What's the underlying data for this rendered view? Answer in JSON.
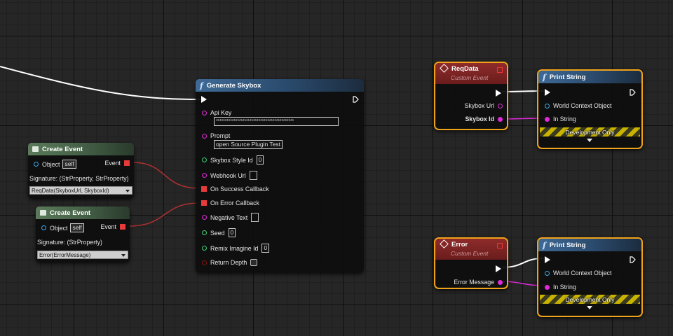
{
  "generate_skybox": {
    "title": "Generate Skybox",
    "api_key_label": "Api Key",
    "api_key_value": "********************************************",
    "prompt_label": "Prompt",
    "prompt_value": "open Source Plugin Test",
    "skybox_style_id_label": "Skybox Style Id",
    "skybox_style_id_value": "0",
    "webhook_url_label": "Webhook Url",
    "on_success_label": "On Success Callback",
    "on_error_label": "On Error Callback",
    "negative_text_label": "Negative Text",
    "seed_label": "Seed",
    "seed_value": "0",
    "remix_label": "Remix Imagine Id",
    "remix_value": "0",
    "return_depth_label": "Return Depth"
  },
  "create_event_1": {
    "title": "Create Event",
    "object_label": "Object",
    "object_value": "self",
    "event_label": "Event",
    "signature": "Signature: (StrProperty, StrProperty)",
    "function_value": "ReqData(SkyboxUrl, SkyboxId)"
  },
  "create_event_2": {
    "title": "Create Event",
    "object_label": "Object",
    "object_value": "self",
    "event_label": "Event",
    "signature": "Signature: (StrProperty)",
    "function_value": "Error(ErrorMessage)"
  },
  "reqdata_event": {
    "title": "ReqData",
    "subtitle": "Custom Event",
    "out1_label": "Skybox Url",
    "out2_label": "Skybox Id"
  },
  "error_event": {
    "title": "Error",
    "subtitle": "Custom Event",
    "out1_label": "Error Message"
  },
  "print_string_1": {
    "title": "Print String",
    "world_context_label": "World Context Object",
    "in_string_label": "In String",
    "dev_only_label": "Development Only"
  },
  "print_string_2": {
    "title": "Print String",
    "world_context_label": "World Context Object",
    "in_string_label": "In String",
    "dev_only_label": "Development Only"
  },
  "colors": {
    "exec_wire": "#ffffff",
    "delegate_wire": "#b03030",
    "string_wire": "#e02ad8",
    "selection": "#f0a31a"
  },
  "icons": [
    "function-icon",
    "event-icon",
    "create-event-icon",
    "exec-pin-icon",
    "expand-arrow-icon"
  ]
}
